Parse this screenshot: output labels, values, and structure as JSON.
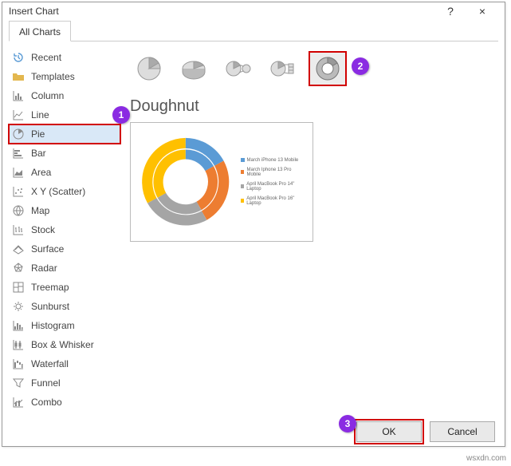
{
  "dialog": {
    "title": "Insert Chart",
    "help_symbol": "?",
    "close_symbol": "×"
  },
  "tabs": {
    "all_charts": "All Charts"
  },
  "sidebar": {
    "items": [
      {
        "label": "Recent"
      },
      {
        "label": "Templates"
      },
      {
        "label": "Column"
      },
      {
        "label": "Line"
      },
      {
        "label": "Pie"
      },
      {
        "label": "Bar"
      },
      {
        "label": "Area"
      },
      {
        "label": "X Y (Scatter)"
      },
      {
        "label": "Map"
      },
      {
        "label": "Stock"
      },
      {
        "label": "Surface"
      },
      {
        "label": "Radar"
      },
      {
        "label": "Treemap"
      },
      {
        "label": "Sunburst"
      },
      {
        "label": "Histogram"
      },
      {
        "label": "Box & Whisker"
      },
      {
        "label": "Waterfall"
      },
      {
        "label": "Funnel"
      },
      {
        "label": "Combo"
      }
    ]
  },
  "callouts": {
    "one": "1",
    "two": "2",
    "three": "3"
  },
  "main": {
    "chart_title": "Doughnut",
    "legend": [
      "March iPhone 13 Mobile",
      "March Iphone 13 Pro Mobile",
      "April MacBook Pro 14\" Laptop",
      "April MacBook Pro 16\" Laptop"
    ]
  },
  "colors": {
    "blue": "#5b9bd5",
    "orange": "#ed7d31",
    "gray": "#a5a5a5",
    "yellow": "#ffc000"
  },
  "footer": {
    "ok": "OK",
    "cancel": "Cancel"
  },
  "watermark": "wsxdn.com"
}
